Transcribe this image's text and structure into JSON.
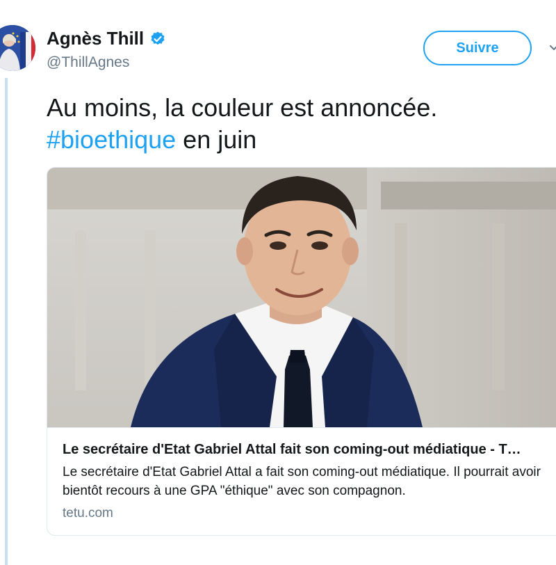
{
  "tweet": {
    "author_name": "Agnès Thill",
    "author_handle": "@ThillAgnes",
    "follow_label": "Suivre",
    "text_before": "Au moins, la couleur est annoncée.",
    "hashtag": "#bioethique",
    "text_after": " en juin"
  },
  "card": {
    "title": "Le secrétaire d'Etat Gabriel Attal fait son coming-out médiatique - T…",
    "description": "Le secrétaire d'Etat Gabriel Attal a fait son coming-out médiatique. Il pourrait avoir bientôt recours à une GPA \"éthique\" avec son compagnon.",
    "domain": "tetu.com"
  },
  "colors": {
    "accent": "#1da1f2",
    "verified": "#1da1f2",
    "thread_line": "#c4dff2",
    "secondary_text": "#657786"
  },
  "icons": {
    "verified": "verified-badge-icon",
    "caret": "chevron-down-icon"
  }
}
